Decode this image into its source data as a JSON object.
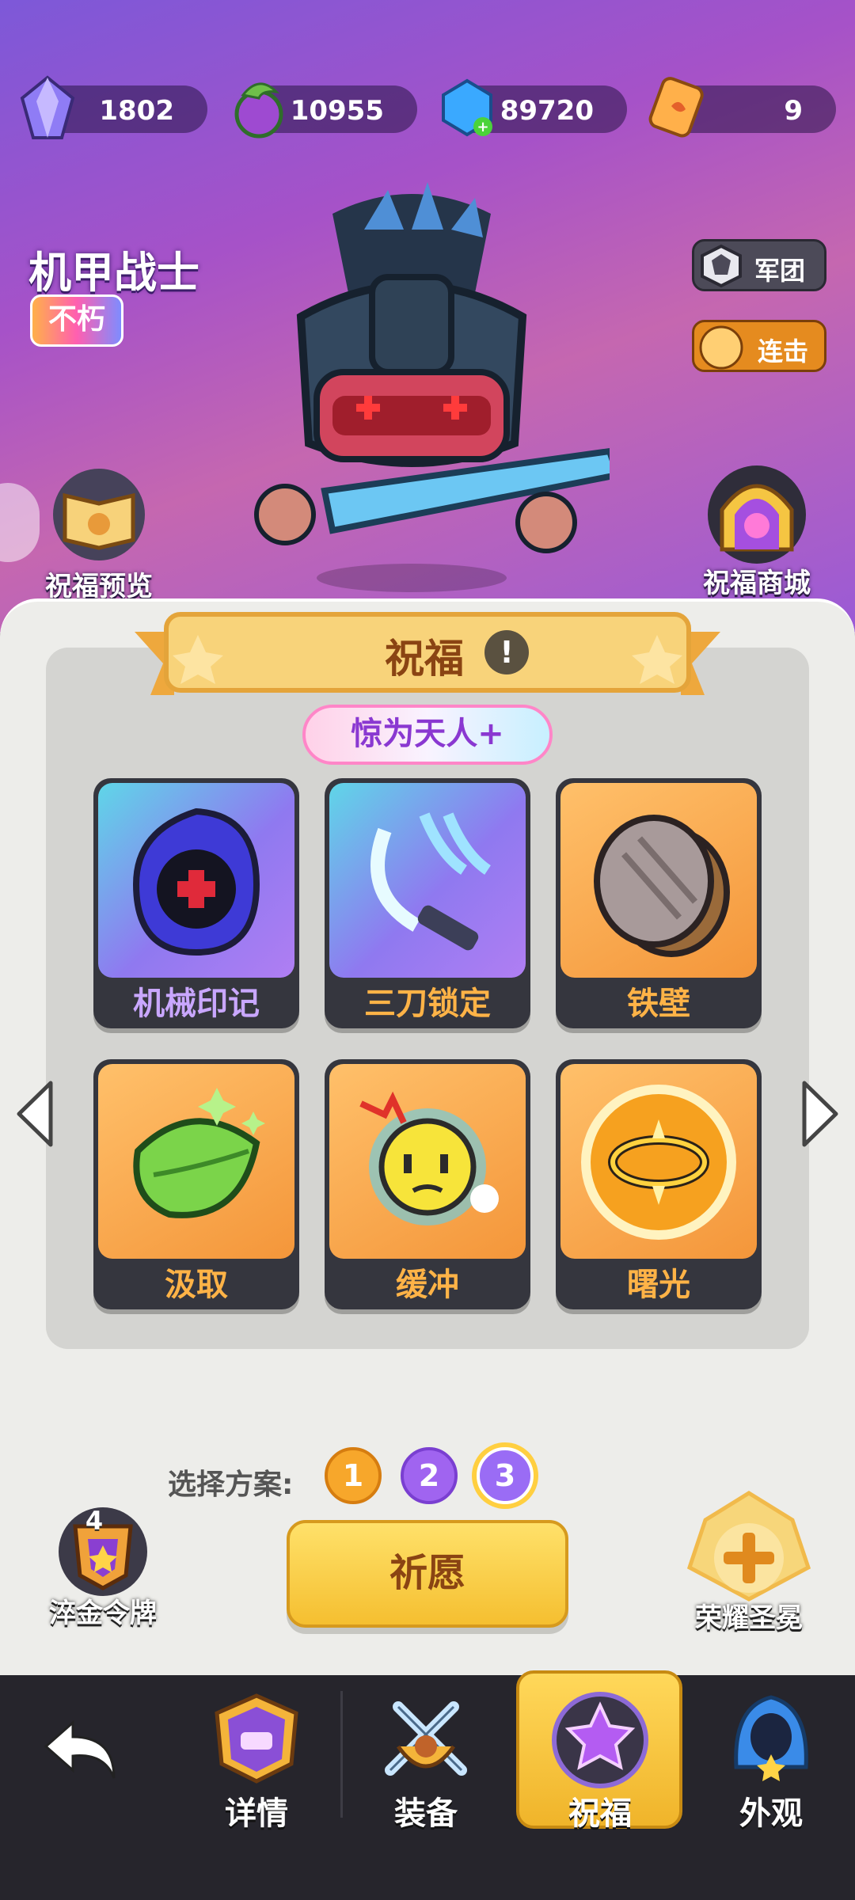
{
  "currencies": [
    {
      "name": "crystal",
      "icon": "purple-crystal-icon",
      "value": "1802"
    },
    {
      "name": "potion",
      "icon": "green-potion-icon",
      "value": "10955"
    },
    {
      "name": "gem",
      "icon": "blue-gem-plus-icon",
      "value": "89720"
    },
    {
      "name": "scroll",
      "icon": "orange-scroll-icon",
      "value": "9"
    }
  ],
  "hero": {
    "name": "机甲战士",
    "rank": "不朽"
  },
  "buttons": {
    "legion": "军团",
    "combo": "连击",
    "bless_preview": "祝福预览",
    "bless_shop": "祝福商城",
    "pray": "祈愿",
    "token": "淬金令牌",
    "token_count": "4",
    "shrine": "荣耀圣冕"
  },
  "bless": {
    "title": "祝福",
    "info_icon": "!",
    "quality": "惊为天人+",
    "cards": [
      {
        "label": "机械印记",
        "tier": "purple",
        "icon": "mech-mark-icon"
      },
      {
        "label": "三刀锁定",
        "tier": "purple",
        "icon": "triple-blade-icon"
      },
      {
        "label": "铁壁",
        "tier": "orange",
        "icon": "iron-shield-icon"
      },
      {
        "label": "汲取",
        "tier": "orange",
        "icon": "leaf-drain-icon"
      },
      {
        "label": "缓冲",
        "tier": "orange",
        "icon": "buffer-face-icon"
      },
      {
        "label": "曙光",
        "tier": "orange",
        "icon": "dawn-halo-icon"
      }
    ]
  },
  "plan": {
    "label": "选择方案:",
    "options": [
      "1",
      "2",
      "3"
    ],
    "selected": "3"
  },
  "nav": [
    {
      "label": "详情",
      "icon": "helmet-icon"
    },
    {
      "label": "装备",
      "icon": "crossed-swords-icon"
    },
    {
      "label": "祝福",
      "icon": "star-badge-icon",
      "active": true
    },
    {
      "label": "外观",
      "icon": "hood-icon"
    }
  ],
  "colors": {
    "accent_gold": "#f7c94b",
    "purple_tier": "#c9a7ff",
    "orange_tier": "#ffb347"
  }
}
